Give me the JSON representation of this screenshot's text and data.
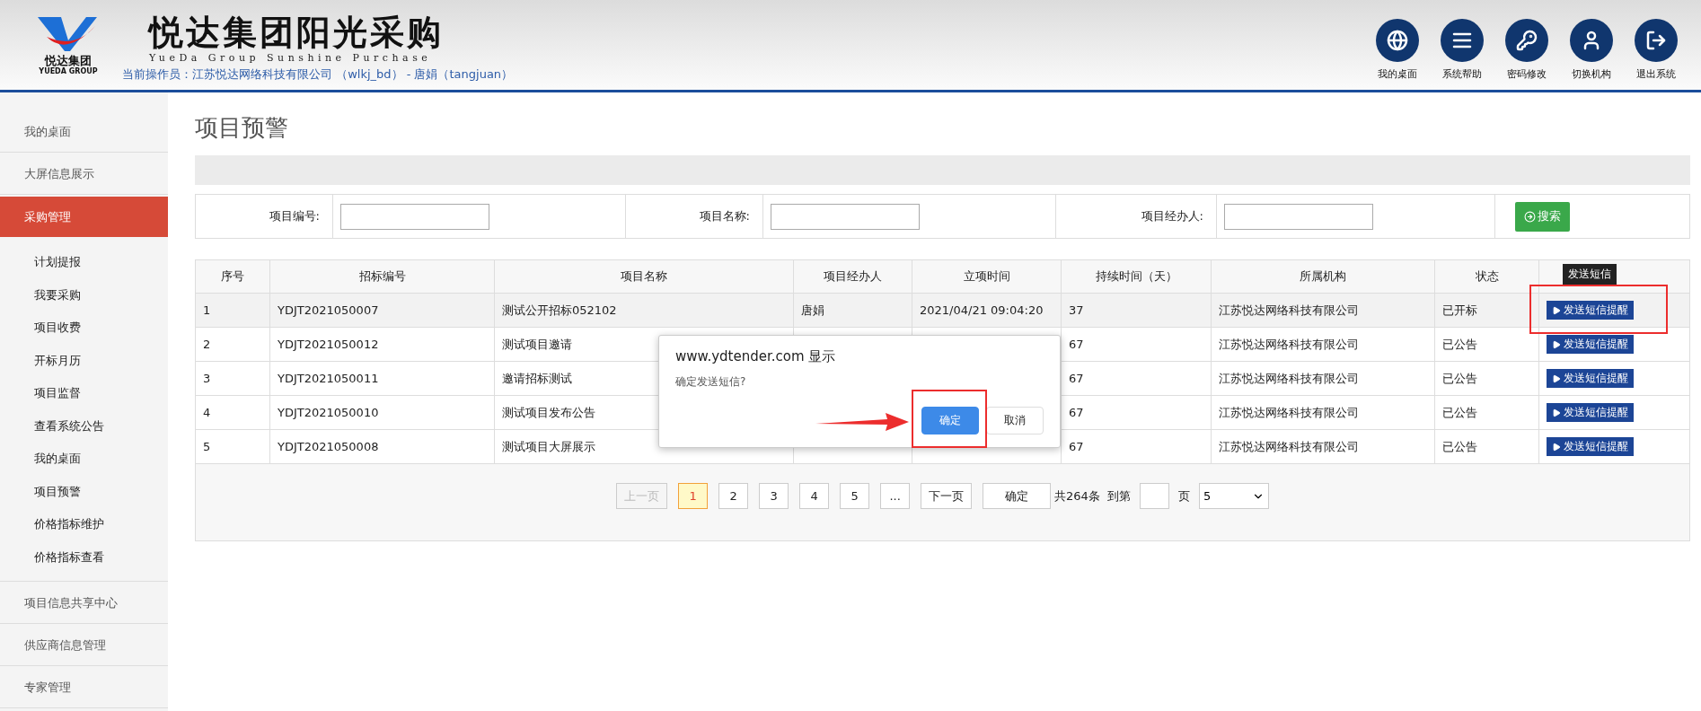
{
  "header": {
    "logo_text": "悦达集团",
    "logo_subtext": "YUEDA GROUP",
    "title": "悦达集团阳光采购",
    "subtitle": "YueDa Group Sunshine Purchase",
    "operator": "当前操作员：江苏悦达网络科技有限公司 （wlkj_bd） - 唐娟（tangjuan）"
  },
  "nav": [
    {
      "label": "我的桌面"
    },
    {
      "label": "系统帮助"
    },
    {
      "label": "密码修改"
    },
    {
      "label": "切换机构"
    },
    {
      "label": "退出系统"
    }
  ],
  "sidebar": {
    "items": [
      {
        "label": "我的桌面",
        "selected": false
      },
      {
        "label": "大屏信息展示",
        "selected": false
      },
      {
        "label": "采购管理",
        "selected": true,
        "expanded": true,
        "children": [
          {
            "label": "计划提报"
          },
          {
            "label": "我要采购"
          },
          {
            "label": "项目收费"
          },
          {
            "label": "开标月历"
          },
          {
            "label": "项目监督"
          },
          {
            "label": "查看系统公告"
          },
          {
            "label": "我的桌面"
          },
          {
            "label": "项目预警"
          },
          {
            "label": "价格指标维护"
          },
          {
            "label": "价格指标查看"
          }
        ]
      },
      {
        "label": "项目信息共享中心",
        "selected": false
      },
      {
        "label": "供应商信息管理",
        "selected": false
      },
      {
        "label": "专家管理",
        "selected": false
      }
    ]
  },
  "page_title": "项目预警",
  "search": {
    "fields": [
      {
        "label": "项目编号:"
      },
      {
        "label": "项目名称:"
      },
      {
        "label": "项目经办人:"
      }
    ],
    "button": "搜索"
  },
  "table": {
    "columns": [
      "序号",
      "招标编号",
      "项目名称",
      "项目经办人",
      "立项时间",
      "持续时间（天）",
      "所属机构",
      "状态"
    ],
    "rows": [
      {
        "no": "1",
        "code": "YDJT2021050007",
        "name": "测试公开招标052102",
        "handler": "唐娟",
        "created": "2021/04/21 09:04:20",
        "days": "37",
        "org": "江苏悦达网络科技有限公司",
        "status": "已开标",
        "action": "发送短信提醒",
        "hovered": true
      },
      {
        "no": "2",
        "code": "YDJT2021050012",
        "name": "测试项目邀请",
        "days": "67",
        "org": "江苏悦达网络科技有限公司",
        "status": "已公告",
        "action": "发送短信提醒",
        "hovered": false
      },
      {
        "no": "3",
        "code": "YDJT2021050011",
        "name": "邀请招标测试",
        "days": "67",
        "org": "江苏悦达网络科技有限公司",
        "status": "已公告",
        "action": "发送短信提醒",
        "hovered": false
      },
      {
        "no": "4",
        "code": "YDJT2021050010",
        "name": "测试项目发布公告",
        "days": "67",
        "org": "江苏悦达网络科技有限公司",
        "status": "已公告",
        "action": "发送短信提醒",
        "hovered": false
      },
      {
        "no": "5",
        "code": "YDJT2021050008",
        "name": "测试项目大屏展示",
        "days": "67",
        "org": "江苏悦达网络科技有限公司",
        "status": "已公告",
        "action": "发送短信提醒",
        "hovered": false
      }
    ]
  },
  "tooltip": "发送短信",
  "pagination": {
    "prev": {
      "label": "上一页",
      "disabled": true
    },
    "pages": [
      {
        "label": "1",
        "selected": true
      },
      {
        "label": "2",
        "selected": false
      },
      {
        "label": "3",
        "selected": false
      },
      {
        "label": "4",
        "selected": false
      },
      {
        "label": "5",
        "selected": false
      },
      {
        "label": "...",
        "selected": false
      }
    ],
    "next": "下一页",
    "confirm": "确定",
    "total": "共264条",
    "goto_label": "到第",
    "page_suffix": "页",
    "page_size": "5"
  },
  "dialog": {
    "title": "www.ydtender.com 显示",
    "message": "确定发送短信?",
    "buttons": [
      {
        "label": "确定",
        "kind": "primary"
      },
      {
        "label": "取消",
        "kind": "secondary"
      }
    ]
  }
}
